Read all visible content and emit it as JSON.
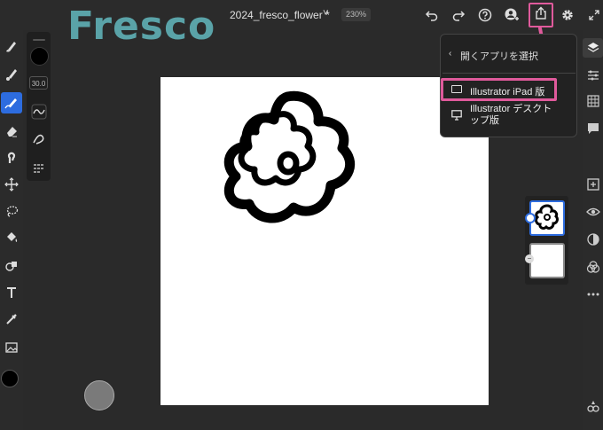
{
  "branding": {
    "app_title": "Fresco"
  },
  "header": {
    "document_title": "2024_fresco_flower *",
    "zoom_level": "230%",
    "chevron": "˅"
  },
  "toolbar": {
    "undo_icon": "undo-icon",
    "redo_icon": "redo-icon",
    "help_icon": "help-icon",
    "account_icon": "account-icon",
    "share_icon": "share-icon",
    "settings_icon": "gear-icon",
    "fullscreen_icon": "fullscreen-icon"
  },
  "brush_panel": {
    "size": "30.0"
  },
  "share_popup": {
    "back_glyph": "‹",
    "title": "開くアプリを選択",
    "items": [
      {
        "label": "Illustrator iPad 版",
        "icon": "tablet-icon"
      },
      {
        "label": "Illustrator デスクトップ版",
        "icon": "desktop-icon"
      }
    ]
  },
  "layers": {
    "count": 2
  },
  "colors": {
    "accent": "#2d6cdf",
    "highlight": "#e05a9c",
    "brand": "#5aa3a8",
    "background": "#2a2a2a"
  }
}
